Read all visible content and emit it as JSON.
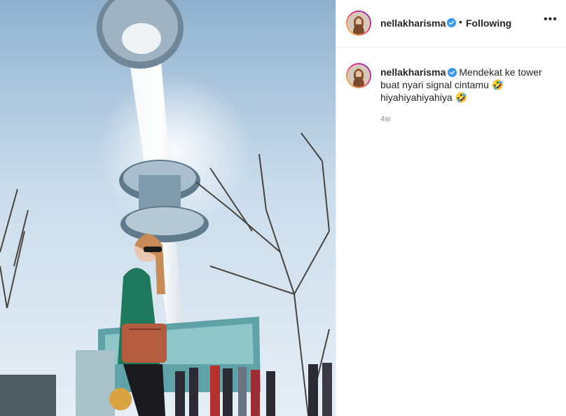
{
  "post": {
    "username": "nellakharisma",
    "separator": "•",
    "follow_label": "Following",
    "more_label": "•••",
    "caption": "Mendekat ke tower buat nyari signal cintamu 🤣 hiyahiyahiyahiya 🤣",
    "age": "4w"
  },
  "colors": {
    "verified": "#3897f0",
    "text": "#262626",
    "muted": "#8e8e8e",
    "border": "#efefef"
  },
  "icons": {
    "verified": "verified-badge-icon",
    "more": "more-options-icon"
  }
}
